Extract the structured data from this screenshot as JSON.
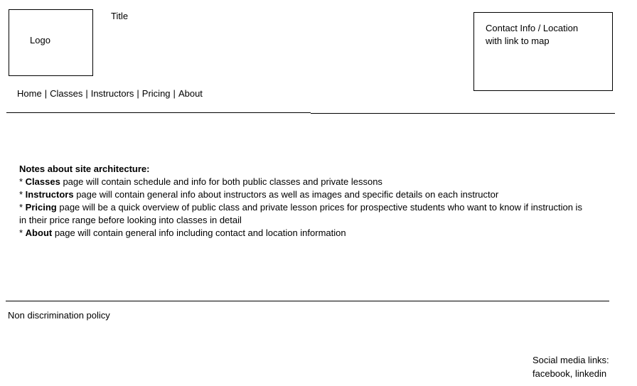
{
  "header": {
    "logo_label": "Logo",
    "title": "Title",
    "contact": {
      "line1": "Contact Info / Location",
      "line2": "with link to map"
    }
  },
  "nav": {
    "items": [
      {
        "label": "Home"
      },
      {
        "label": "Classes"
      },
      {
        "label": "Instructors"
      },
      {
        "label": "Pricing"
      },
      {
        "label": "About"
      }
    ],
    "separator": "|"
  },
  "notes": {
    "heading": "Notes about site architecture:",
    "items": [
      {
        "bullet": "* ",
        "keyword": "Classes",
        "text": " page will contain schedule and info for both public classes and private lessons"
      },
      {
        "bullet": "* ",
        "keyword": "Instructors",
        "text": " page will contain general info about instructors as well as images and specific details on each instructor"
      },
      {
        "bullet": "* ",
        "keyword": "Pricing",
        "text": " page will be a quick overview of public class and private lesson prices for prospective students who want to know if instruction is in their price range before looking into classes in detail"
      },
      {
        "bullet": "* ",
        "keyword": "About",
        "text": " page will contain general info including contact and location information"
      }
    ]
  },
  "footer": {
    "policy": "Non discrimination policy",
    "social": {
      "line1": "Social media links:",
      "line2": "facebook, linkedin"
    }
  }
}
